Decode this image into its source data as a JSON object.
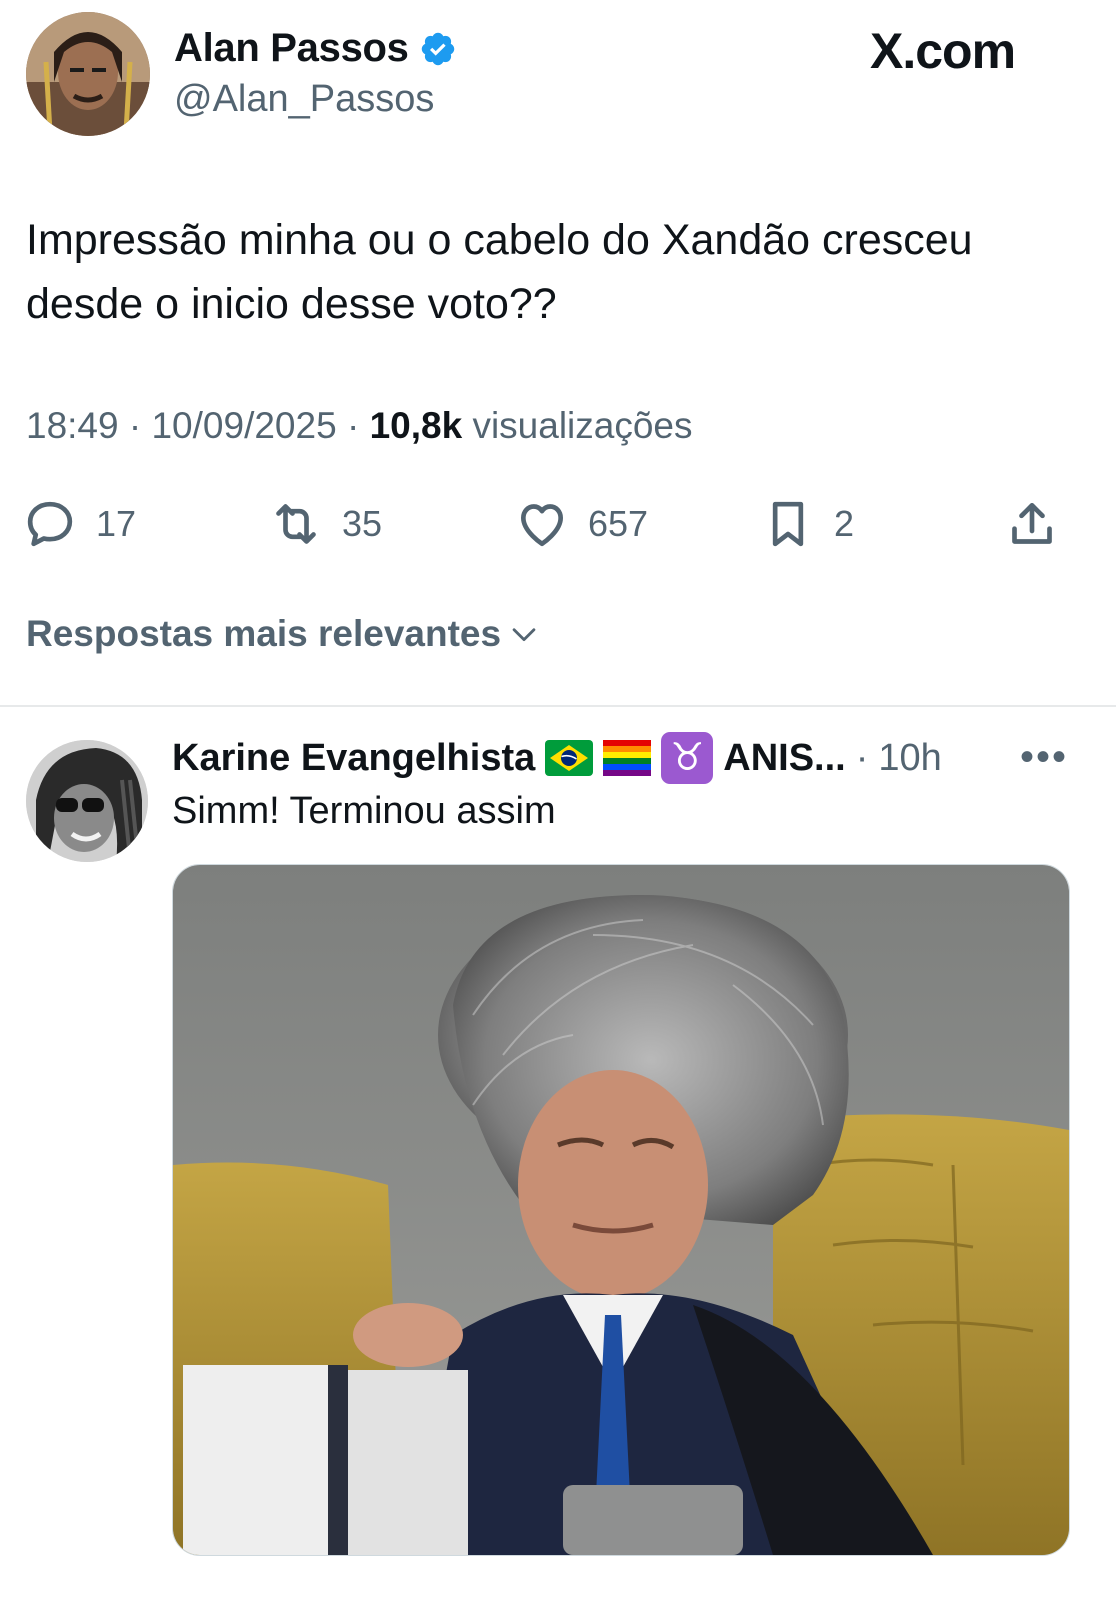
{
  "author": {
    "name": "Alan Passos",
    "handle": "@Alan_Passos",
    "verified_icon": "verified-badge-icon",
    "verified_color": "#1d9bf0"
  },
  "brand": "X.com",
  "tweet": {
    "text": "Impressão minha ou o cabelo do Xandão cresceu desde o inicio desse voto??",
    "time": "18:49",
    "date": "10/09/2025",
    "views_count": "10,8k",
    "views_label": "visualizações"
  },
  "actions": {
    "replies": "17",
    "reposts": "35",
    "likes": "657",
    "bookmarks": "2"
  },
  "sort": {
    "label": "Respostas mais relevantes"
  },
  "reply": {
    "name": "Karine Evangelhista",
    "name_suffix": "ANIS...",
    "time": "10h",
    "text": "Simm! Terminou assim",
    "more_label": "•••",
    "emoji_icons": [
      "brazil-flag-icon",
      "pride-flag-icon",
      "taurus-icon"
    ],
    "taurus_glyph": "♉"
  },
  "colors": {
    "text": "#0f1419",
    "secondary": "#536471",
    "divider": "#e7e9ea",
    "accent": "#1d9bf0"
  }
}
